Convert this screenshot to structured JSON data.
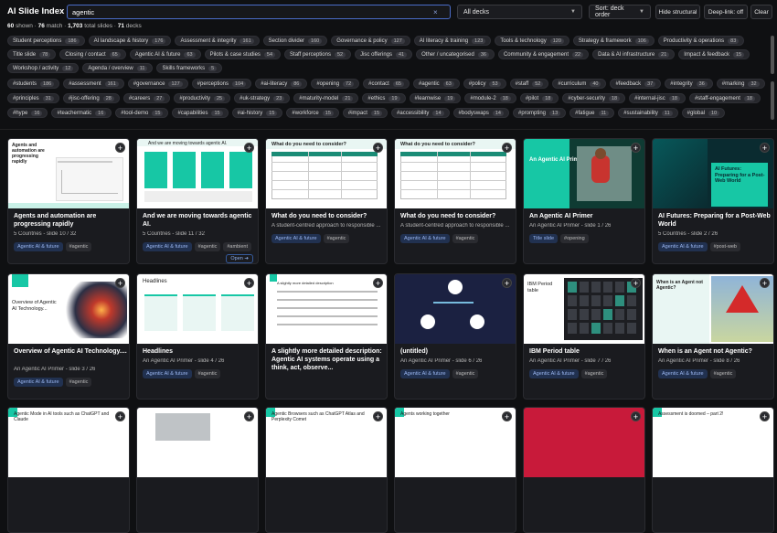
{
  "app": {
    "title": "AI Slide Index"
  },
  "search": {
    "value": "agentic",
    "clear_icon": "×"
  },
  "decks_select": {
    "value": "All decks"
  },
  "sort_select": {
    "value": "Sort: deck order"
  },
  "buttons": {
    "hide_structural": "Hide structural",
    "deep_link": "Deep-link: off",
    "clear": "Clear"
  },
  "stats": {
    "shown": "60",
    "shown_label": " shown · ",
    "match": "76",
    "match_label": " match · ",
    "total": "1,703",
    "total_label": " total slides · ",
    "decks": "71",
    "decks_label": " decks"
  },
  "chip_rows": [
    [
      {
        "label": "Student perceptions",
        "count": "186"
      },
      {
        "label": "AI landscape & history",
        "count": "176"
      },
      {
        "label": "Assessment & integrity",
        "count": "161"
      },
      {
        "label": "Section divider",
        "count": "160"
      },
      {
        "label": "Governance & policy",
        "count": "127"
      },
      {
        "label": "AI literacy & training",
        "count": "123"
      },
      {
        "label": "Tools & technology",
        "count": "120"
      },
      {
        "label": "Strategy & framework",
        "count": "106"
      },
      {
        "label": "Productivity & operations",
        "count": "83"
      }
    ],
    [
      {
        "label": "Title slide",
        "count": "78"
      },
      {
        "label": "Closing / contact",
        "count": "65"
      },
      {
        "label": "Agentic AI & future",
        "count": "63"
      },
      {
        "label": "Pilots & case studies",
        "count": "54"
      },
      {
        "label": "Staff perceptions",
        "count": "52"
      },
      {
        "label": "Jisc offerings",
        "count": "41"
      },
      {
        "label": "Other / uncategorised",
        "count": "36"
      },
      {
        "label": "Community & engagement",
        "count": "22"
      },
      {
        "label": "Data & AI infrastructure",
        "count": "21"
      },
      {
        "label": "Impact & feedback",
        "count": "15"
      }
    ],
    [
      {
        "label": "Workshop / activity",
        "count": "12"
      },
      {
        "label": "Agenda / overview",
        "count": "11"
      },
      {
        "label": "Skills frameworks",
        "count": "5"
      }
    ],
    [
      {
        "label": "#students",
        "count": "186"
      },
      {
        "label": "#assessment",
        "count": "161"
      },
      {
        "label": "#governance",
        "count": "127"
      },
      {
        "label": "#perceptions",
        "count": "104"
      },
      {
        "label": "#ai-literacy",
        "count": "86"
      },
      {
        "label": "#opening",
        "count": "72"
      },
      {
        "label": "#contact",
        "count": "65"
      },
      {
        "label": "#agentic",
        "count": "63"
      },
      {
        "label": "#policy",
        "count": "53"
      },
      {
        "label": "#staff",
        "count": "52"
      },
      {
        "label": "#curriculum",
        "count": "40"
      },
      {
        "label": "#feedback",
        "count": "37"
      },
      {
        "label": "#integrity",
        "count": "36"
      },
      {
        "label": "#marking",
        "count": "32"
      }
    ],
    [
      {
        "label": "#principles",
        "count": "31"
      },
      {
        "label": "#jisc-offering",
        "count": "28"
      },
      {
        "label": "#careers",
        "count": "27"
      },
      {
        "label": "#productivity",
        "count": "25"
      },
      {
        "label": "#uk-strategy",
        "count": "23"
      },
      {
        "label": "#maturity-model",
        "count": "21"
      },
      {
        "label": "#ethics",
        "count": "19"
      },
      {
        "label": "#learnwise",
        "count": "19"
      },
      {
        "label": "#module-2",
        "count": "18"
      },
      {
        "label": "#pilot",
        "count": "18"
      },
      {
        "label": "#cyber-security",
        "count": "18"
      },
      {
        "label": "#internal-jisc",
        "count": "18"
      },
      {
        "label": "#staff-engagement",
        "count": "18"
      }
    ],
    [
      {
        "label": "#hype",
        "count": "16"
      },
      {
        "label": "#teachermatic",
        "count": "16"
      },
      {
        "label": "#tool-demo",
        "count": "15"
      },
      {
        "label": "#capabilities",
        "count": "15"
      },
      {
        "label": "#ai-history",
        "count": "15"
      },
      {
        "label": "#workforce",
        "count": "15"
      },
      {
        "label": "#impact",
        "count": "15"
      },
      {
        "label": "#accessibility",
        "count": "14"
      },
      {
        "label": "#bodyswaps",
        "count": "14"
      },
      {
        "label": "#prompting",
        "count": "13"
      },
      {
        "label": "#fatigue",
        "count": "11"
      },
      {
        "label": "#sustainability",
        "count": "11"
      },
      {
        "label": "#global",
        "count": "10"
      }
    ]
  ],
  "cards": [
    {
      "title": "Agents and automation are progressing rapidly",
      "sub": "5 Countries - slide 10 / 32",
      "tags": [
        "Agentic AI & future",
        "#agentic"
      ],
      "thumb": "Agents and automation are progressing rapidly"
    },
    {
      "title": "And we are moving towards agentic AI.",
      "sub": "5 Countries - slide 11 / 32",
      "tags": [
        "Agentic AI & future",
        "#agentic",
        "#ambient"
      ],
      "open": "Open ➔",
      "thumb": "And we are moving towards agentic AI."
    },
    {
      "title": "What do you need to consider?",
      "sub": "A student-centred approach to responsible ...",
      "tags": [
        "Agentic AI & future",
        "#agentic"
      ],
      "thumb": "What do you need to consider?"
    },
    {
      "title": "What do you need to consider?",
      "sub": "A student-centred approach to responsible ...",
      "tags": [
        "Agentic AI & future",
        "#agentic"
      ],
      "thumb": "What do you need to consider?"
    },
    {
      "title": "An Agentic AI Primer",
      "sub": "An Agentic AI Primer - slide 1 / 26",
      "tags": [
        "Title slide",
        "#opening"
      ],
      "thumb": "An Agentic AI Primer"
    },
    {
      "title": "AI Futures: Preparing for a Post-Web World",
      "sub": "5 Countries - slide 2 / 26",
      "tags": [
        "Agentic AI & future",
        "#post-web"
      ],
      "thumb": "AI Futures: Preparing for a Post-Web World"
    },
    {
      "title": "Overview of Agentic AI Technology....",
      "sub": "An Agentic AI Primer - slide 3 / 26",
      "tags": [
        "Agentic AI & future",
        "#agentic"
      ],
      "thumb": "Overview of Agentic AI Technology..."
    },
    {
      "title": "Headlines",
      "sub": "An Agentic AI Primer - slide 4 / 26",
      "tags": [
        "Agentic AI & future",
        "#agentic"
      ],
      "thumb": "Headlines"
    },
    {
      "title": "A slightly more detailed description:  Agentic AI systems operate using a think, act, observe...",
      "sub": "",
      "tags": [],
      "thumb": "A slightly more detailed description"
    },
    {
      "title": "(untitled)",
      "sub": "An Agentic AI Primer - slide 6 / 26",
      "tags": [
        "Agentic AI & future",
        "#agentic"
      ],
      "thumb": ""
    },
    {
      "title": "IBM Period table",
      "sub": "An Agentic AI Primer - slide 7 / 26",
      "tags": [
        "Agentic AI & future",
        "#agentic"
      ],
      "thumb": "IBM Period table"
    },
    {
      "title": "When is an Agent not Agentic?",
      "sub": "An Agentic AI Primer - slide 8 / 26",
      "tags": [
        "Agentic AI & future",
        "#agentic"
      ],
      "thumb": "When is an Agent not Agentic?"
    },
    {
      "title": "",
      "sub": "",
      "tags": [],
      "thumb": "Agentic Mode in AI tools such as ChatGPT and Claude"
    },
    {
      "title": "",
      "sub": "",
      "tags": [],
      "thumb": ""
    },
    {
      "title": "",
      "sub": "",
      "tags": [],
      "thumb": "Agentic Browsers such as ChatGPT Atlas and Perplexity Comet"
    },
    {
      "title": "",
      "sub": "",
      "tags": [],
      "thumb": "Agents working together"
    },
    {
      "title": "",
      "sub": "",
      "tags": [],
      "thumb": ""
    },
    {
      "title": "",
      "sub": "",
      "tags": [],
      "thumb": "Assessment is doomed – part 2!"
    }
  ]
}
